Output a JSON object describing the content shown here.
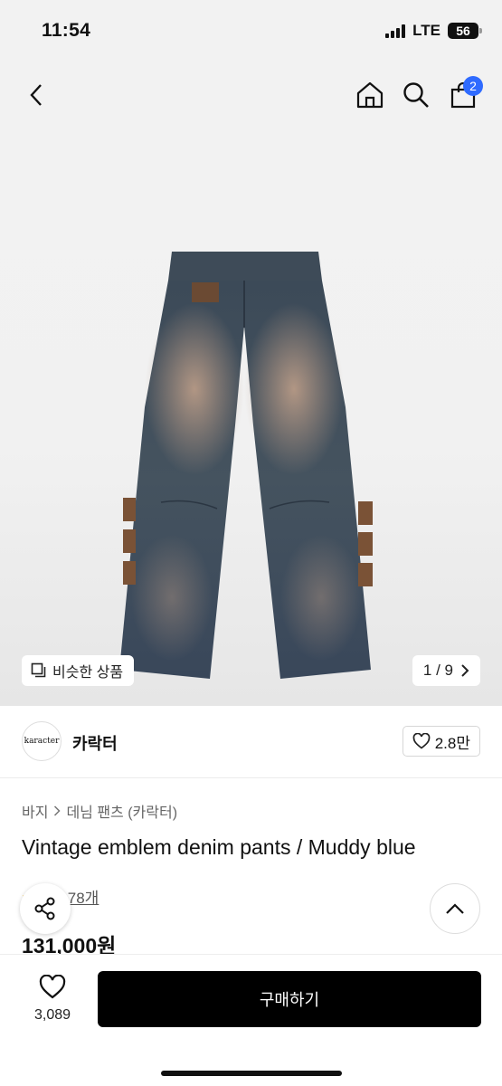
{
  "status_bar": {
    "time": "11:54",
    "network": "LTE",
    "battery": "56",
    "battery_level": 0.56
  },
  "header": {
    "cart_count": "2"
  },
  "gallery": {
    "similar_label": "비슷한 상품",
    "page_indicator": "1 / 9"
  },
  "brand": {
    "logo_text": "karacter",
    "name": "카락터",
    "likes": "2.8만"
  },
  "breadcrumb": [
    "바지",
    "데님 팬츠 (카락터)"
  ],
  "product": {
    "title": "Vintage emblem denim pants / Muddy blue",
    "review_text": "후기 78개",
    "price": "131,000원"
  },
  "bottom_bar": {
    "wish_count": "3,089",
    "buy_label": "구매하기"
  },
  "colors": {
    "accent": "#2f6bff",
    "buy_button": "#000000",
    "star": "#f5b301"
  }
}
